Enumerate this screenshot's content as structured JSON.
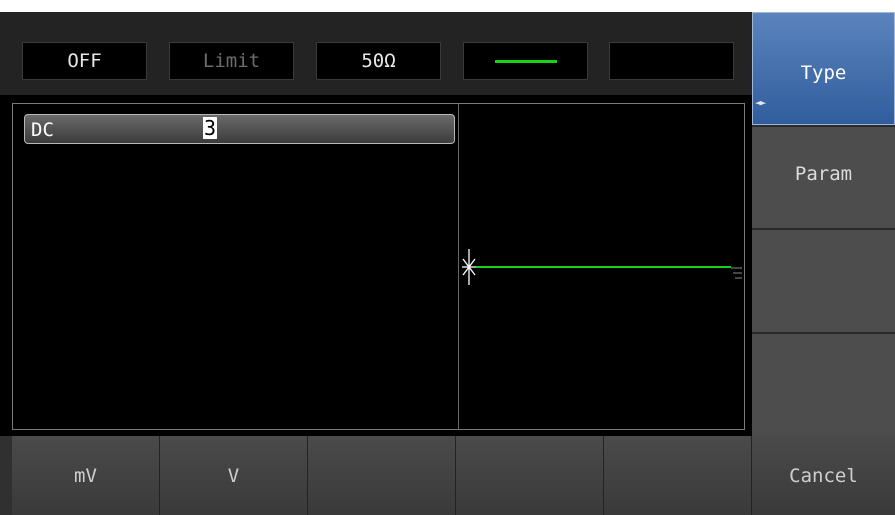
{
  "status": {
    "output": "OFF",
    "limit": "Limit",
    "load": "50Ω",
    "wave_color": "#18d218"
  },
  "param": {
    "name": "DC",
    "value": "3"
  },
  "waveform": {
    "type": "DC",
    "start_marker": "cross-marker-icon",
    "end_marker": "ground-icon",
    "color": "#18d218"
  },
  "softkeys": [
    {
      "label": "Type",
      "active": true,
      "indicator": "◄►"
    },
    {
      "label": "Param",
      "active": false
    },
    {
      "label": "",
      "active": false
    },
    {
      "label": "",
      "active": false
    }
  ],
  "bottomkeys": [
    {
      "label": "mV"
    },
    {
      "label": "V"
    },
    {
      "label": ""
    },
    {
      "label": ""
    },
    {
      "label": ""
    },
    {
      "label": "Cancel"
    }
  ]
}
